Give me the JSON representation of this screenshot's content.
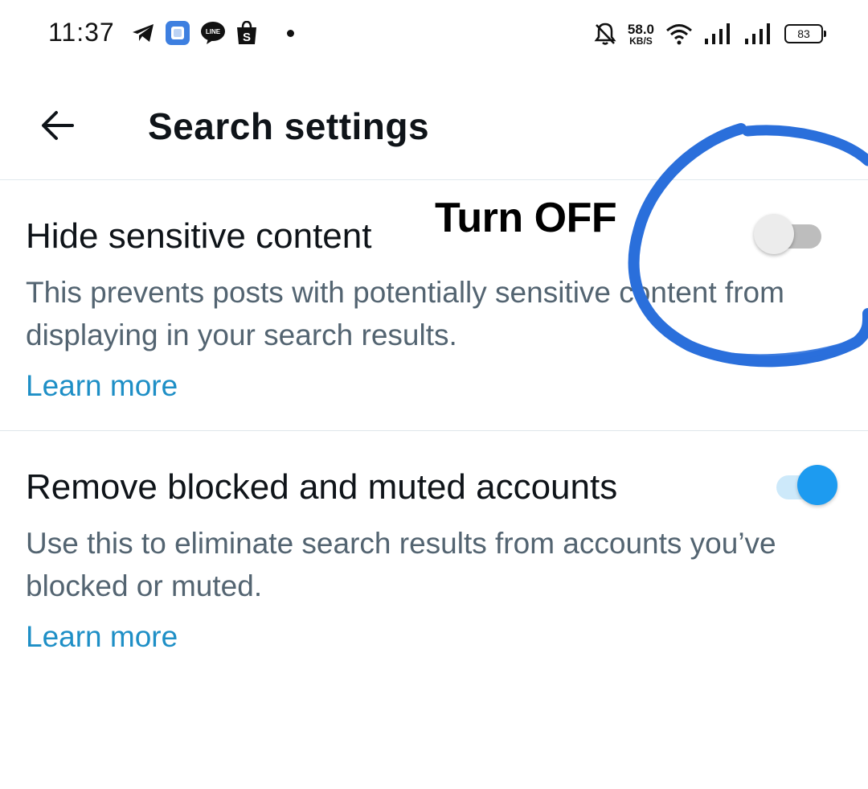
{
  "status_bar": {
    "time": "11:37",
    "net_speed_value": "58.0",
    "net_speed_unit": "KB/S",
    "battery": "83",
    "icons": [
      "telegram-icon",
      "app-icon",
      "line-icon",
      "shopee-icon",
      "dot-icon",
      "bell-off-icon",
      "wifi-icon",
      "signal-icon",
      "signal-icon",
      "battery-icon"
    ]
  },
  "header": {
    "title": "Search settings",
    "back_icon": "arrow-left-icon"
  },
  "settings": [
    {
      "title": "Hide sensitive content",
      "description": "This prevents posts with potentially sensitive content from displaying in your search results.",
      "link": "Learn more",
      "enabled": false
    },
    {
      "title": "Remove blocked and muted accounts",
      "description": "Use this to eliminate search results from accounts you’ve blocked or muted.",
      "link": "Learn more",
      "enabled": true
    }
  ],
  "annotation": {
    "label": "Turn OFF",
    "circle_color": "#2a6fdb"
  },
  "colors": {
    "accent": "#1d9bf0",
    "link": "#1e8fc6",
    "secondary_text": "#536471",
    "annotation_blue": "#2a6fdb"
  }
}
